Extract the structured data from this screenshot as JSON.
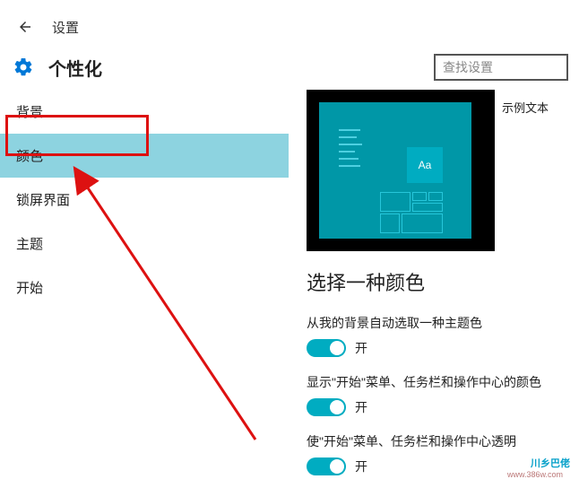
{
  "header": {
    "title": "设置"
  },
  "page": {
    "title": "个性化",
    "search_placeholder": "查找设置"
  },
  "sidebar": {
    "items": [
      {
        "label": "背景"
      },
      {
        "label": "颜色"
      },
      {
        "label": "锁屏界面"
      },
      {
        "label": "主题"
      },
      {
        "label": "开始"
      }
    ]
  },
  "preview": {
    "sample_text": "示例文本",
    "tile_label": "Aa"
  },
  "main": {
    "section_title": "选择一种颜色",
    "settings": [
      {
        "label": "从我的背景自动选取一种主题色",
        "state": "开"
      },
      {
        "label": "显示\"开始\"菜单、任务栏和操作中心的颜色",
        "state": "开"
      },
      {
        "label": "使\"开始\"菜单、任务栏和操作中心透明",
        "state": "开"
      }
    ]
  },
  "watermark": {
    "main": "川乡巴佬",
    "sub": "www.386w.com"
  }
}
